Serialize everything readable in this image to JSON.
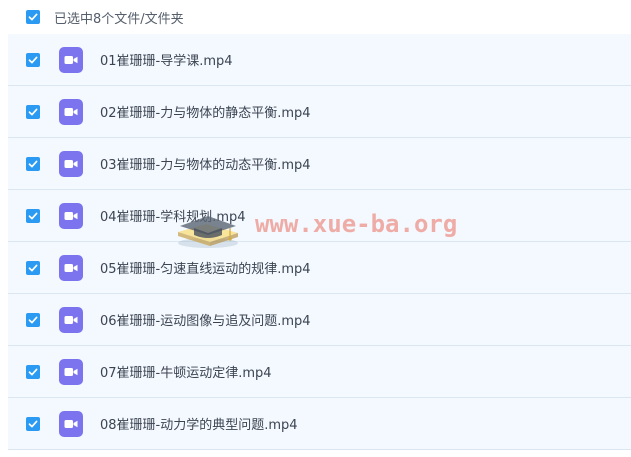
{
  "header": {
    "selection_text": "已选中8个文件/文件夹"
  },
  "files": [
    {
      "name": "01崔珊珊-导学课.mp4"
    },
    {
      "name": "02崔珊珊-力与物体的静态平衡.mp4"
    },
    {
      "name": "03崔珊珊-力与物体的动态平衡.mp4"
    },
    {
      "name": "04崔珊珊-学科规划.mp4"
    },
    {
      "name": "05崔珊珊-匀速直线运动的规律.mp4"
    },
    {
      "name": "06崔珊珊-运动图像与追及问题.mp4"
    },
    {
      "name": "07崔珊珊-牛顿运动定律.mp4"
    },
    {
      "name": "08崔珊珊-动力学的典型问题.mp4"
    }
  ],
  "watermark": {
    "text": "www.xue-ba.org"
  },
  "icons": {
    "checkbox": "checkbox-checked-icon",
    "file": "video-file-icon"
  },
  "colors": {
    "checkbox": "#2b9af3",
    "video_icon": "#7b74ee",
    "row_background": "#f3f9fe",
    "row_divider": "#dbe6f0",
    "watermark": "#eb6e5f"
  }
}
